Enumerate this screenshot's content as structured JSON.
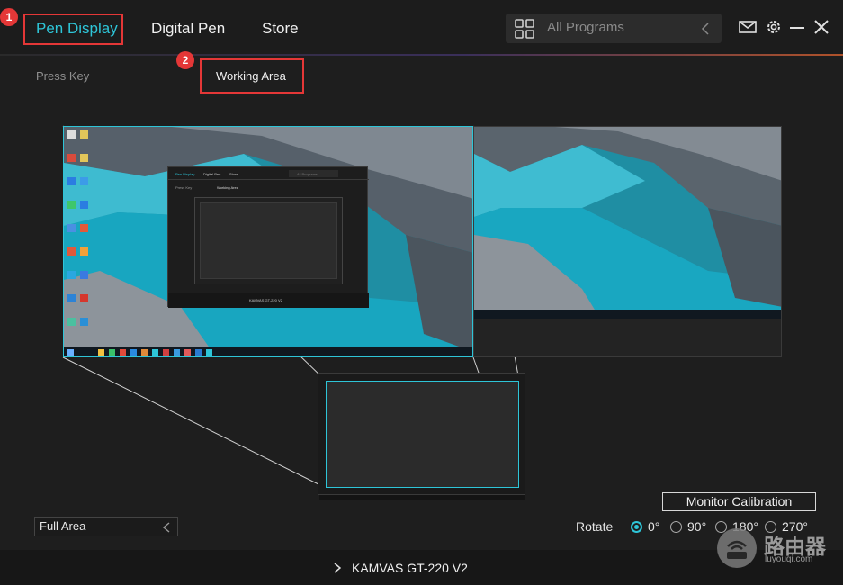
{
  "nav": {
    "tab1": "Pen Display",
    "tab2": "Digital Pen",
    "tab3": "Store",
    "badge1": "1",
    "badge2": "2"
  },
  "search": {
    "placeholder": "All Programs"
  },
  "subtabs": {
    "press_key": "Press Key",
    "working_area": "Working Area"
  },
  "inner": {
    "tab1": "Pen Display",
    "tab2": "Digital Pen",
    "tab3": "Store",
    "search": "All Programs",
    "press_key": "Press Key",
    "working_area": "Working Area",
    "device": "KAMVAS GT-220 V2"
  },
  "area": {
    "selected": "Full Area"
  },
  "calibration": {
    "label": "Monitor Calibration"
  },
  "rotate": {
    "label": "Rotate",
    "options": [
      "0°",
      "90°",
      "180°",
      "270°"
    ]
  },
  "footer": {
    "device": "KAMVAS GT-220 V2"
  },
  "watermark": {
    "name": "路由器",
    "url": "luyouqi.com"
  },
  "colors": {
    "accent": "#2ec5d8",
    "highlight": "#e43737"
  },
  "icons": {
    "grid": "grid-icon",
    "mail": "mail-icon",
    "settings": "gear-icon",
    "minimize": "minimize-icon",
    "close": "close-icon"
  }
}
